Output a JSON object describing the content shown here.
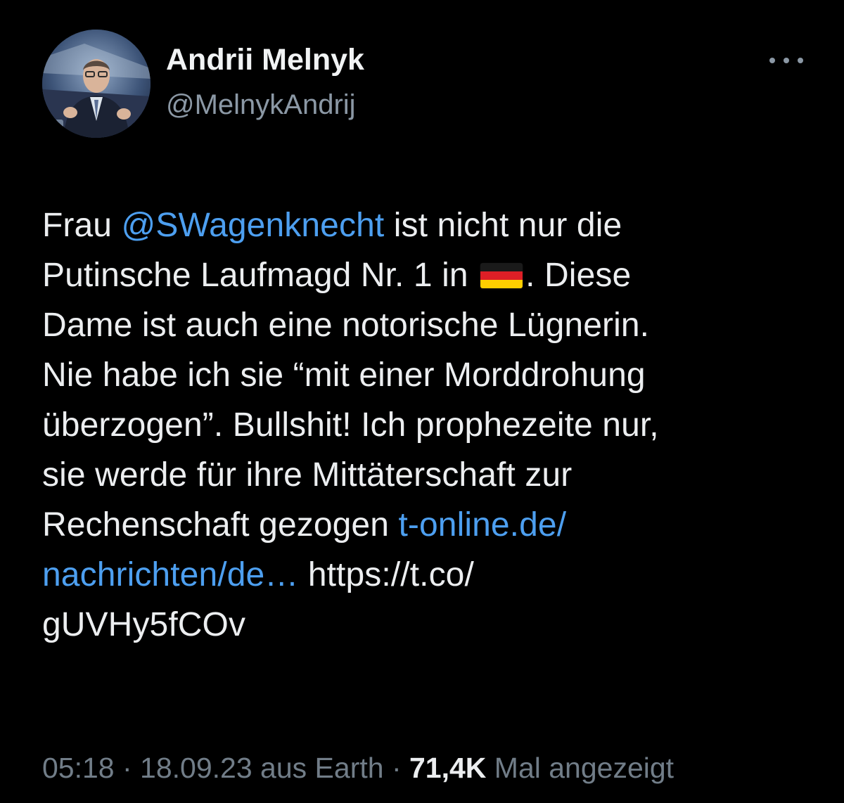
{
  "author": {
    "display_name": "Andrii Melnyk",
    "handle": "@MelnykAndrij"
  },
  "tweet": {
    "line1_pre": "Frau ",
    "mention": "@SWagenknecht",
    "line1_post": " ist nicht nur die",
    "line2_pre": "Putinsche Laufmagd Nr. 1 in ",
    "flag_icon": "germany-flag-emoji",
    "line2_post": ". Diese",
    "line3": "Dame ist auch eine notorische Lügnerin.",
    "line4": "Nie habe ich sie “mit einer Morddrohung",
    "line5": "überzogen”. Bullshit! Ich prophezeite nur,",
    "line6": "sie werde für ihre Mittäterschaft zur",
    "line7_pre": "Rechenschaft gezogen ",
    "link_part1": "t-online.de/",
    "link_part2": "nachrichten/de…",
    "short_url_part1": " https://t.co/",
    "short_url_part2": "gUVHy5fCOv"
  },
  "meta": {
    "time": "05:18",
    "separator": " · ",
    "date": "18.09.23",
    "source": " aus Earth",
    "separator2": " · ",
    "views_count": "71,4K",
    "views_label": " Mal angezeigt"
  },
  "colors": {
    "background": "#000000",
    "text": "#e7e9ea",
    "secondary": "#8b98a5",
    "link": "#4d9ff0"
  }
}
